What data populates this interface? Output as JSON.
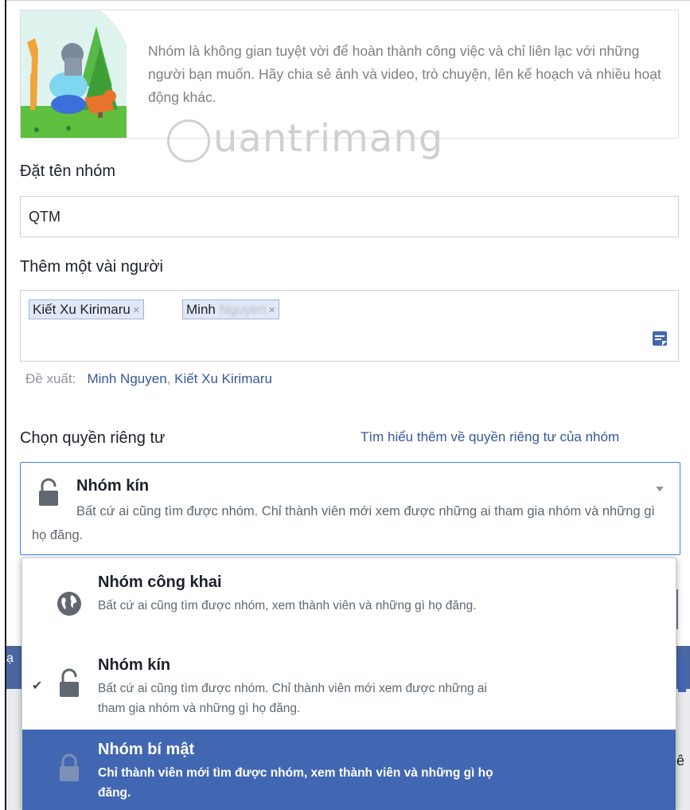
{
  "hero": {
    "description": "Nhóm là không gian tuyệt vời để hoàn thành công việc và chỉ liên lạc với những người bạn muốn. Hãy chia sẻ ảnh và video, trò chuyện, lên kế hoạch và nhiều hoạt động khác."
  },
  "watermark": "uantrimang",
  "group_name": {
    "label": "Đặt tên nhóm",
    "value": "QTM"
  },
  "members": {
    "label": "Thêm một vài người",
    "chips": [
      {
        "name": "Kiết Xu Kirimaru",
        "remove": "×"
      },
      {
        "name": "Minh",
        "name_blurred": "Nguyen",
        "remove": "×"
      }
    ]
  },
  "suggestions": {
    "label": "Đề xuất:",
    "names": [
      "Minh Nguyen",
      "Kiết Xu Kirimaru"
    ],
    "separator": ", "
  },
  "privacy": {
    "label": "Chọn quyền riêng tư",
    "learn_more": "Tìm hiểu thêm về quyền riêng tư của nhóm",
    "selected": {
      "title": "Nhóm kín",
      "description": "Bất cứ ai cũng tìm được nhóm. Chỉ thành viên mới xem được những ai tham gia nhóm và những gì họ đăng."
    },
    "options": [
      {
        "title": "Nhóm công khai",
        "description": "Bất cứ ai cũng tìm được nhóm, xem thành viên và những gì họ đăng.",
        "icon": "globe-icon",
        "checked": false,
        "highlighted": false
      },
      {
        "title": "Nhóm kín",
        "description": "Bất cứ ai cũng tìm được nhóm. Chỉ thành viên mới xem được những ai tham gia nhóm và những gì họ đăng.",
        "icon": "lock-open-icon",
        "checked": true,
        "highlighted": false
      },
      {
        "title": "Nhóm bí mật",
        "description": "Chỉ thành viên mới tìm được nhóm, xem thành viên và những gì họ đăng.",
        "icon": "lock-closed-icon",
        "checked": false,
        "highlighted": true
      }
    ],
    "check_mark": "✔"
  },
  "background": {
    "left_text": "ạ",
    "right_text": "ê"
  },
  "colors": {
    "link": "#365899",
    "highlight": "#4267b2",
    "focus_border": "#4080ff",
    "muted_text": "#606770"
  }
}
